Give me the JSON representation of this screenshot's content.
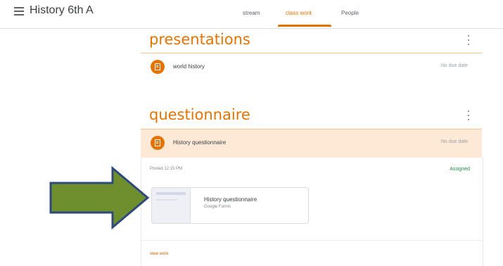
{
  "header": {
    "class_title": "History 6th A",
    "tabs": [
      {
        "label": "stream"
      },
      {
        "label": "class work"
      },
      {
        "label": "People"
      }
    ]
  },
  "sections": [
    {
      "title": "presentations",
      "items": [
        {
          "title": "world history",
          "due": "No due date"
        }
      ]
    },
    {
      "title": "questionnaire",
      "items": [
        {
          "title": "History questionnaire",
          "due": "No due date",
          "posted": "Posted 12:15 PM",
          "status": "Assigned",
          "attachment": {
            "title": "History questionnaire",
            "subtitle": "Google Forms"
          },
          "view_work": "view work"
        }
      ]
    }
  ],
  "colors": {
    "accent": "#e37400",
    "highlight": "#fde9d6",
    "assigned": "#1e8e3e",
    "arrow_fill": "#6f8f2e",
    "arrow_stroke": "#2e4a7a"
  },
  "icons": [
    "menu-icon",
    "assignment-icon",
    "more-vert-icon",
    "arrow-annotation"
  ]
}
